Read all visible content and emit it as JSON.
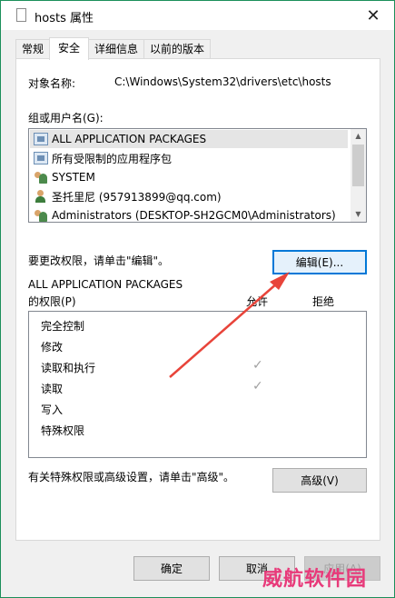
{
  "window": {
    "title": "hosts 属性",
    "close_glyph": "✕"
  },
  "tabs": [
    {
      "label": "常规"
    },
    {
      "label": "安全"
    },
    {
      "label": "详细信息"
    },
    {
      "label": "以前的版本"
    }
  ],
  "security": {
    "object_name_label": "对象名称:",
    "object_name_value": "C:\\Windows\\System32\\drivers\\etc\\hosts",
    "group_label": "组或用户名(G):",
    "users": [
      {
        "name": "ALL APPLICATION PACKAGES",
        "icon": "package-icon"
      },
      {
        "name": "所有受限制的应用程序包",
        "icon": "package-icon"
      },
      {
        "name": "SYSTEM",
        "icon": "group-icon"
      },
      {
        "name": "圣托里尼 (957913899@qq.com)",
        "icon": "user-icon"
      },
      {
        "name": "Administrators (DESKTOP-SH2GCM0\\Administrators)",
        "icon": "group-icon"
      }
    ],
    "change_hint": "要更改权限，请单击\"编辑\"。",
    "edit_button": "编辑(E)...",
    "perm_for_line1": "ALL APPLICATION PACKAGES",
    "perm_for_line2": "的权限(P)",
    "allow_header": "允许",
    "deny_header": "拒绝",
    "permissions": [
      {
        "name": "完全控制",
        "allow": false
      },
      {
        "name": "修改",
        "allow": false
      },
      {
        "name": "读取和执行",
        "allow": true
      },
      {
        "name": "读取",
        "allow": true
      },
      {
        "name": "写入",
        "allow": false
      },
      {
        "name": "特殊权限",
        "allow": false
      }
    ],
    "check_glyph": "✓",
    "advanced_hint": "有关特殊权限或高级设置，请单击\"高级\"。",
    "advanced_button": "高级(V)"
  },
  "footer": {
    "ok_button": "确定",
    "cancel_button": "取消",
    "apply_button": "应用(A)"
  },
  "watermark": "威航软件园",
  "colors": {
    "annotation_arrow": "#e8443a",
    "window_border": "#1c8f5a",
    "focus_border": "#0078d7"
  }
}
